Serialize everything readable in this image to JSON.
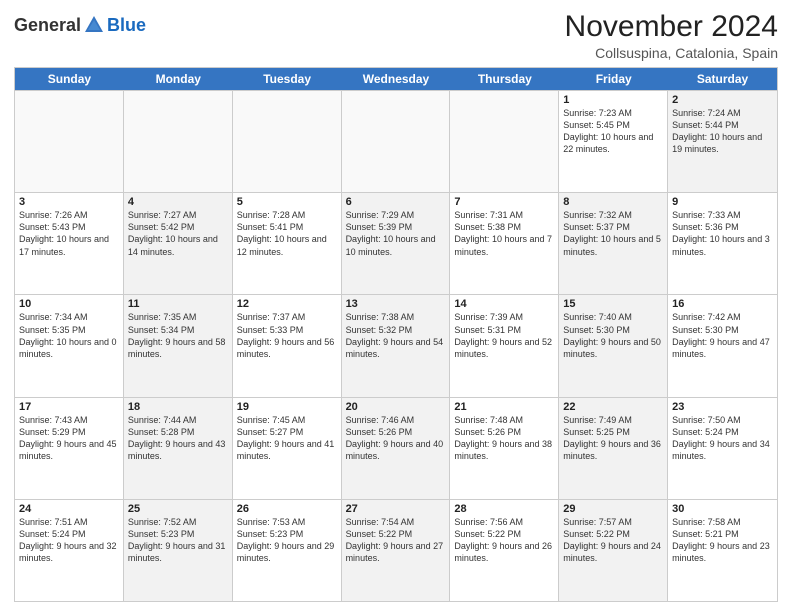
{
  "logo": {
    "general": "General",
    "blue": "Blue"
  },
  "title": "November 2024",
  "location": "Collsuspina, Catalonia, Spain",
  "header": {
    "days": [
      "Sunday",
      "Monday",
      "Tuesday",
      "Wednesday",
      "Thursday",
      "Friday",
      "Saturday"
    ]
  },
  "rows": [
    [
      {
        "day": "",
        "info": "",
        "shaded": false,
        "empty": true
      },
      {
        "day": "",
        "info": "",
        "shaded": false,
        "empty": true
      },
      {
        "day": "",
        "info": "",
        "shaded": false,
        "empty": true
      },
      {
        "day": "",
        "info": "",
        "shaded": false,
        "empty": true
      },
      {
        "day": "",
        "info": "",
        "shaded": false,
        "empty": true
      },
      {
        "day": "1",
        "info": "Sunrise: 7:23 AM\nSunset: 5:45 PM\nDaylight: 10 hours and 22 minutes.",
        "shaded": false,
        "empty": false
      },
      {
        "day": "2",
        "info": "Sunrise: 7:24 AM\nSunset: 5:44 PM\nDaylight: 10 hours and 19 minutes.",
        "shaded": true,
        "empty": false
      }
    ],
    [
      {
        "day": "3",
        "info": "Sunrise: 7:26 AM\nSunset: 5:43 PM\nDaylight: 10 hours and 17 minutes.",
        "shaded": false,
        "empty": false
      },
      {
        "day": "4",
        "info": "Sunrise: 7:27 AM\nSunset: 5:42 PM\nDaylight: 10 hours and 14 minutes.",
        "shaded": true,
        "empty": false
      },
      {
        "day": "5",
        "info": "Sunrise: 7:28 AM\nSunset: 5:41 PM\nDaylight: 10 hours and 12 minutes.",
        "shaded": false,
        "empty": false
      },
      {
        "day": "6",
        "info": "Sunrise: 7:29 AM\nSunset: 5:39 PM\nDaylight: 10 hours and 10 minutes.",
        "shaded": true,
        "empty": false
      },
      {
        "day": "7",
        "info": "Sunrise: 7:31 AM\nSunset: 5:38 PM\nDaylight: 10 hours and 7 minutes.",
        "shaded": false,
        "empty": false
      },
      {
        "day": "8",
        "info": "Sunrise: 7:32 AM\nSunset: 5:37 PM\nDaylight: 10 hours and 5 minutes.",
        "shaded": true,
        "empty": false
      },
      {
        "day": "9",
        "info": "Sunrise: 7:33 AM\nSunset: 5:36 PM\nDaylight: 10 hours and 3 minutes.",
        "shaded": false,
        "empty": false
      }
    ],
    [
      {
        "day": "10",
        "info": "Sunrise: 7:34 AM\nSunset: 5:35 PM\nDaylight: 10 hours and 0 minutes.",
        "shaded": false,
        "empty": false
      },
      {
        "day": "11",
        "info": "Sunrise: 7:35 AM\nSunset: 5:34 PM\nDaylight: 9 hours and 58 minutes.",
        "shaded": true,
        "empty": false
      },
      {
        "day": "12",
        "info": "Sunrise: 7:37 AM\nSunset: 5:33 PM\nDaylight: 9 hours and 56 minutes.",
        "shaded": false,
        "empty": false
      },
      {
        "day": "13",
        "info": "Sunrise: 7:38 AM\nSunset: 5:32 PM\nDaylight: 9 hours and 54 minutes.",
        "shaded": true,
        "empty": false
      },
      {
        "day": "14",
        "info": "Sunrise: 7:39 AM\nSunset: 5:31 PM\nDaylight: 9 hours and 52 minutes.",
        "shaded": false,
        "empty": false
      },
      {
        "day": "15",
        "info": "Sunrise: 7:40 AM\nSunset: 5:30 PM\nDaylight: 9 hours and 50 minutes.",
        "shaded": true,
        "empty": false
      },
      {
        "day": "16",
        "info": "Sunrise: 7:42 AM\nSunset: 5:30 PM\nDaylight: 9 hours and 47 minutes.",
        "shaded": false,
        "empty": false
      }
    ],
    [
      {
        "day": "17",
        "info": "Sunrise: 7:43 AM\nSunset: 5:29 PM\nDaylight: 9 hours and 45 minutes.",
        "shaded": false,
        "empty": false
      },
      {
        "day": "18",
        "info": "Sunrise: 7:44 AM\nSunset: 5:28 PM\nDaylight: 9 hours and 43 minutes.",
        "shaded": true,
        "empty": false
      },
      {
        "day": "19",
        "info": "Sunrise: 7:45 AM\nSunset: 5:27 PM\nDaylight: 9 hours and 41 minutes.",
        "shaded": false,
        "empty": false
      },
      {
        "day": "20",
        "info": "Sunrise: 7:46 AM\nSunset: 5:26 PM\nDaylight: 9 hours and 40 minutes.",
        "shaded": true,
        "empty": false
      },
      {
        "day": "21",
        "info": "Sunrise: 7:48 AM\nSunset: 5:26 PM\nDaylight: 9 hours and 38 minutes.",
        "shaded": false,
        "empty": false
      },
      {
        "day": "22",
        "info": "Sunrise: 7:49 AM\nSunset: 5:25 PM\nDaylight: 9 hours and 36 minutes.",
        "shaded": true,
        "empty": false
      },
      {
        "day": "23",
        "info": "Sunrise: 7:50 AM\nSunset: 5:24 PM\nDaylight: 9 hours and 34 minutes.",
        "shaded": false,
        "empty": false
      }
    ],
    [
      {
        "day": "24",
        "info": "Sunrise: 7:51 AM\nSunset: 5:24 PM\nDaylight: 9 hours and 32 minutes.",
        "shaded": false,
        "empty": false
      },
      {
        "day": "25",
        "info": "Sunrise: 7:52 AM\nSunset: 5:23 PM\nDaylight: 9 hours and 31 minutes.",
        "shaded": true,
        "empty": false
      },
      {
        "day": "26",
        "info": "Sunrise: 7:53 AM\nSunset: 5:23 PM\nDaylight: 9 hours and 29 minutes.",
        "shaded": false,
        "empty": false
      },
      {
        "day": "27",
        "info": "Sunrise: 7:54 AM\nSunset: 5:22 PM\nDaylight: 9 hours and 27 minutes.",
        "shaded": true,
        "empty": false
      },
      {
        "day": "28",
        "info": "Sunrise: 7:56 AM\nSunset: 5:22 PM\nDaylight: 9 hours and 26 minutes.",
        "shaded": false,
        "empty": false
      },
      {
        "day": "29",
        "info": "Sunrise: 7:57 AM\nSunset: 5:22 PM\nDaylight: 9 hours and 24 minutes.",
        "shaded": true,
        "empty": false
      },
      {
        "day": "30",
        "info": "Sunrise: 7:58 AM\nSunset: 5:21 PM\nDaylight: 9 hours and 23 minutes.",
        "shaded": false,
        "empty": false
      }
    ]
  ]
}
